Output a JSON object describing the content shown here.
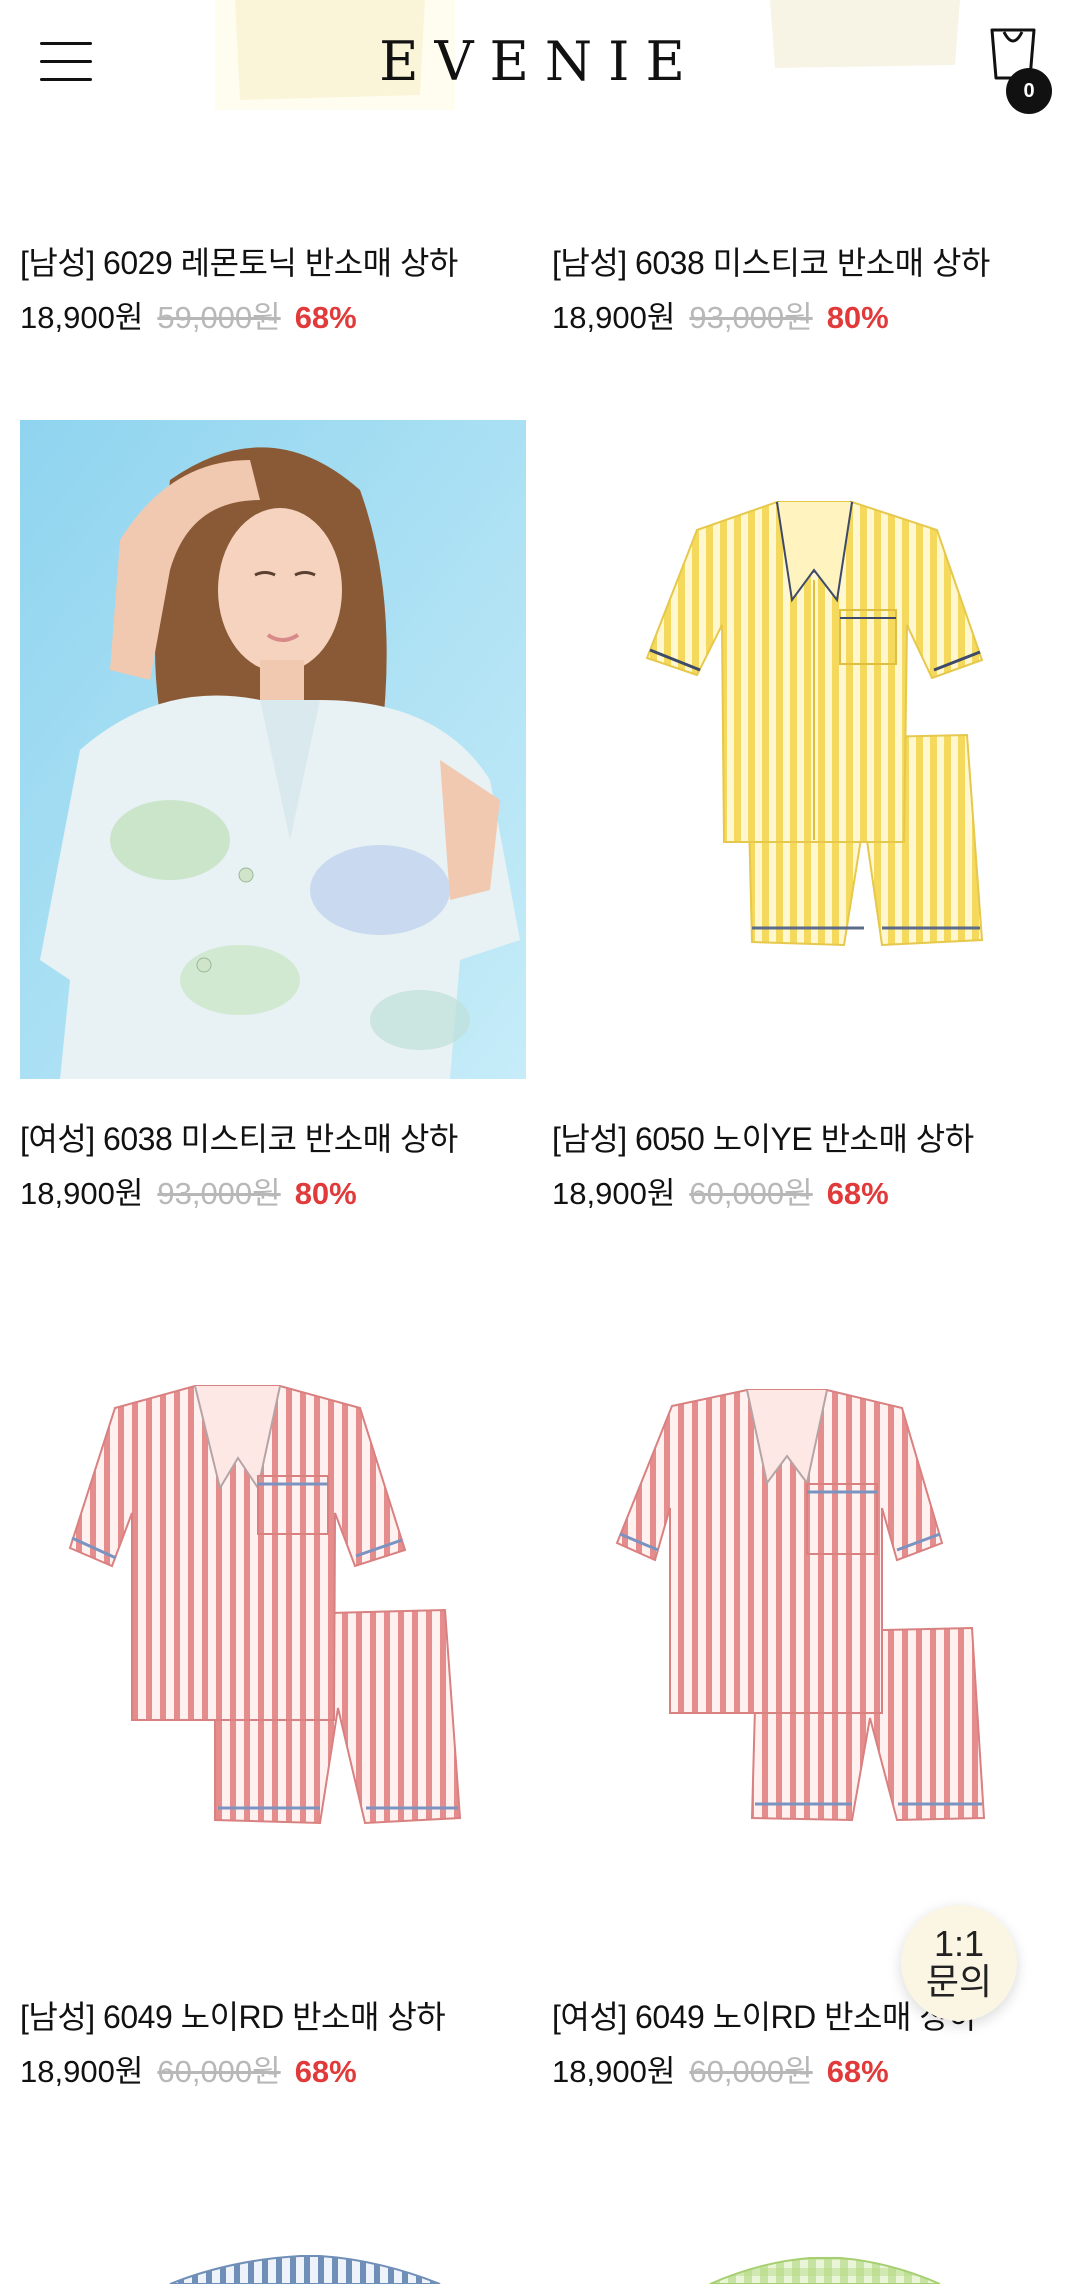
{
  "brand": {
    "logo": "EVENIE"
  },
  "cart": {
    "count": "0"
  },
  "inquiry": {
    "line1": "1:1",
    "line2": "문의"
  },
  "products": [
    {
      "name": "[남성] 6029 레몬토닉 반소매 상하",
      "sale": "18,900원",
      "orig": "59,000원",
      "rate": "68%"
    },
    {
      "name": "[남성] 6038 미스티코 반소매 상하",
      "sale": "18,900원",
      "orig": "93,000원",
      "rate": "80%"
    },
    {
      "name": "[여성] 6038 미스티코 반소매 상하",
      "sale": "18,900원",
      "orig": "93,000원",
      "rate": "80%"
    },
    {
      "name": "[남성] 6050 노이YE 반소매 상하",
      "sale": "18,900원",
      "orig": "60,000원",
      "rate": "68%"
    },
    {
      "name": "[남성] 6049 노이RD 반소매 상하",
      "sale": "18,900원",
      "orig": "60,000원",
      "rate": "68%"
    },
    {
      "name": "[여성] 6049 노이RD 반소매 상하",
      "sale": "18,900원",
      "orig": "60,000원",
      "rate": "68%"
    }
  ],
  "colors": {
    "discount": "#e03a3a",
    "original_price": "#b8b8b8",
    "inquiry_bg": "#fbf6e3",
    "yellow_stripe": "#f4d95c",
    "pink_stripe": "#e58c8c",
    "sky_bg": "#a9dff3"
  }
}
